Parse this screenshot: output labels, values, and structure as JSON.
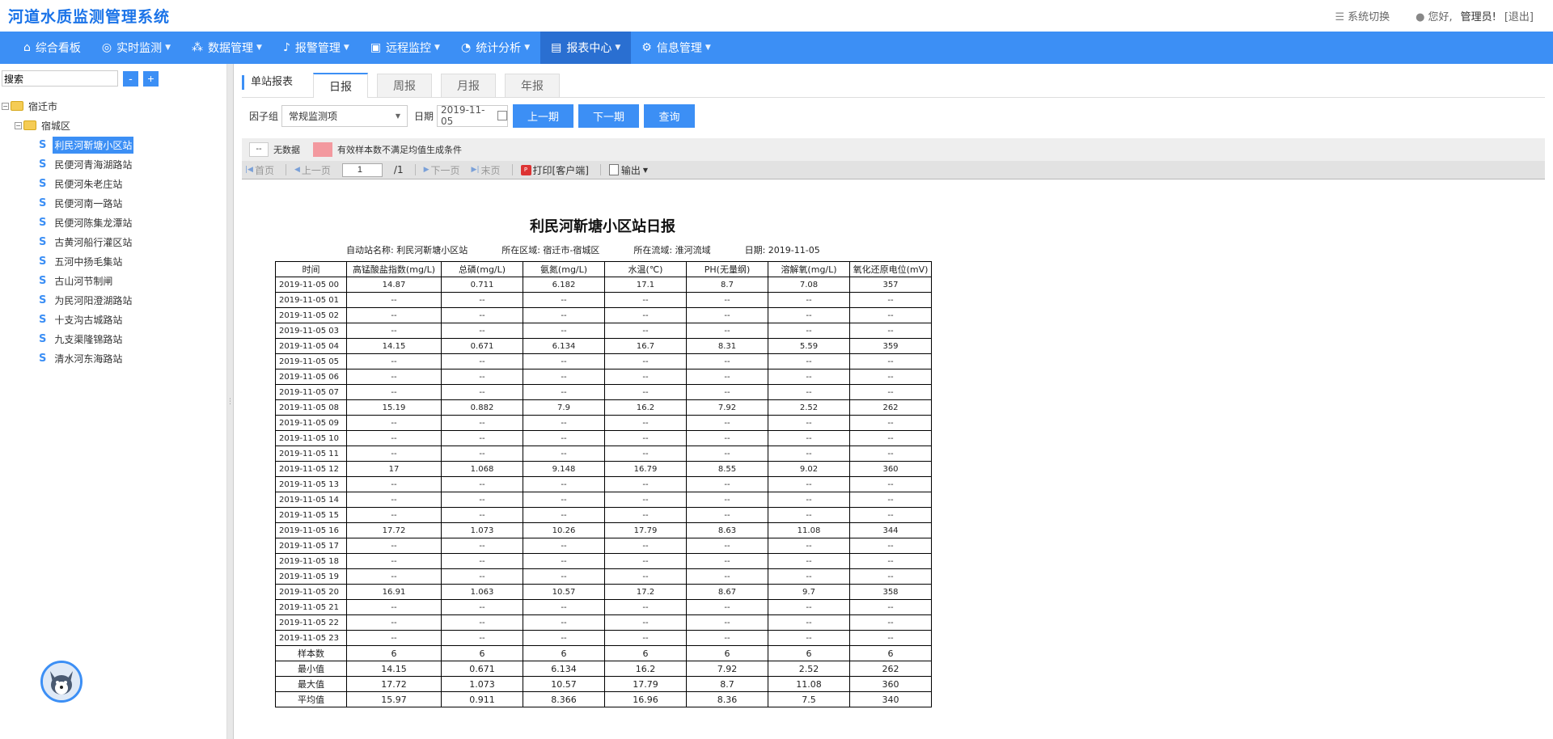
{
  "header": {
    "app_title": "河道水质监测管理系统",
    "switch_system": "系统切换",
    "greeting": "您好,",
    "user": "管理员!",
    "logout": "[退出]"
  },
  "nav": [
    {
      "label": "综合看板",
      "icon": "home-icon",
      "caret": false
    },
    {
      "label": "实时监测",
      "icon": "monitor-icon",
      "caret": true
    },
    {
      "label": "数据管理",
      "icon": "nodes-icon",
      "caret": true
    },
    {
      "label": "报警管理",
      "icon": "bell-icon",
      "caret": true
    },
    {
      "label": "远程监控",
      "icon": "screen-icon",
      "caret": true
    },
    {
      "label": "统计分析",
      "icon": "pie-icon",
      "caret": true
    },
    {
      "label": "报表中心",
      "icon": "report-icon",
      "caret": true,
      "active": true
    },
    {
      "label": "信息管理",
      "icon": "gear-icon",
      "caret": true
    }
  ],
  "sidebar": {
    "search_value": "搜索",
    "minus": "-",
    "plus": "+",
    "root": "宿迁市",
    "district": "宿城区",
    "stations": [
      "利民河靳塘小区站",
      "民便河青海湖路站",
      "民便河朱老庄站",
      "民便河南一路站",
      "民便河陈集龙潭站",
      "古黄河船行灌区站",
      "五河中扬毛集站",
      "古山河节制闸",
      "为民河阳澄湖路站",
      "十支沟古城路站",
      "九支渠隆锦路站",
      "清水河东海路站"
    ],
    "selected_index": 0
  },
  "tabs": {
    "section_label": "单站报表",
    "items": [
      "日报",
      "周报",
      "月报",
      "年报"
    ],
    "active": 0
  },
  "filter": {
    "group_label": "因子组",
    "group_value": "常规监测项",
    "date_label": "日期",
    "date_value": "2019-11-05",
    "prev": "上一期",
    "next": "下一期",
    "query": "查询"
  },
  "legend": {
    "nodata_symbol": "--",
    "nodata_text": "无数据",
    "invalid_text": "有效样本数不满足均值生成条件",
    "invalid_color": "#f3999f"
  },
  "toolbar": {
    "first": "首页",
    "prev": "上一页",
    "page": "1",
    "total": "/1",
    "next": "下一页",
    "last": "末页",
    "print": "打印[客户端]",
    "export": "输出"
  },
  "report": {
    "title": "利民河靳塘小区站日报",
    "station": "自动站名称: 利民河靳塘小区站",
    "region": "所在区域: 宿迁市-宿城区",
    "basin": "所在流域: 淮河流域",
    "date": "日期: 2019-11-05",
    "columns": [
      "时间",
      "高锰酸盐指数(mg/L)",
      "总磷(mg/L)",
      "氨氮(mg/L)",
      "水温(℃)",
      "PH(无量纲)",
      "溶解氧(mg/L)",
      "氧化还原电位(mV)"
    ],
    "rows": [
      [
        "2019-11-05 00",
        "14.87",
        "0.711",
        "6.182",
        "17.1",
        "8.7",
        "7.08",
        "357"
      ],
      [
        "2019-11-05 01",
        "--",
        "--",
        "--",
        "--",
        "--",
        "--",
        "--"
      ],
      [
        "2019-11-05 02",
        "--",
        "--",
        "--",
        "--",
        "--",
        "--",
        "--"
      ],
      [
        "2019-11-05 03",
        "--",
        "--",
        "--",
        "--",
        "--",
        "--",
        "--"
      ],
      [
        "2019-11-05 04",
        "14.15",
        "0.671",
        "6.134",
        "16.7",
        "8.31",
        "5.59",
        "359"
      ],
      [
        "2019-11-05 05",
        "--",
        "--",
        "--",
        "--",
        "--",
        "--",
        "--"
      ],
      [
        "2019-11-05 06",
        "--",
        "--",
        "--",
        "--",
        "--",
        "--",
        "--"
      ],
      [
        "2019-11-05 07",
        "--",
        "--",
        "--",
        "--",
        "--",
        "--",
        "--"
      ],
      [
        "2019-11-05 08",
        "15.19",
        "0.882",
        "7.9",
        "16.2",
        "7.92",
        "2.52",
        "262"
      ],
      [
        "2019-11-05 09",
        "--",
        "--",
        "--",
        "--",
        "--",
        "--",
        "--"
      ],
      [
        "2019-11-05 10",
        "--",
        "--",
        "--",
        "--",
        "--",
        "--",
        "--"
      ],
      [
        "2019-11-05 11",
        "--",
        "--",
        "--",
        "--",
        "--",
        "--",
        "--"
      ],
      [
        "2019-11-05 12",
        "17",
        "1.068",
        "9.148",
        "16.79",
        "8.55",
        "9.02",
        "360"
      ],
      [
        "2019-11-05 13",
        "--",
        "--",
        "--",
        "--",
        "--",
        "--",
        "--"
      ],
      [
        "2019-11-05 14",
        "--",
        "--",
        "--",
        "--",
        "--",
        "--",
        "--"
      ],
      [
        "2019-11-05 15",
        "--",
        "--",
        "--",
        "--",
        "--",
        "--",
        "--"
      ],
      [
        "2019-11-05 16",
        "17.72",
        "1.073",
        "10.26",
        "17.79",
        "8.63",
        "11.08",
        "344"
      ],
      [
        "2019-11-05 17",
        "--",
        "--",
        "--",
        "--",
        "--",
        "--",
        "--"
      ],
      [
        "2019-11-05 18",
        "--",
        "--",
        "--",
        "--",
        "--",
        "--",
        "--"
      ],
      [
        "2019-11-05 19",
        "--",
        "--",
        "--",
        "--",
        "--",
        "--",
        "--"
      ],
      [
        "2019-11-05 20",
        "16.91",
        "1.063",
        "10.57",
        "17.2",
        "8.67",
        "9.7",
        "358"
      ],
      [
        "2019-11-05 21",
        "--",
        "--",
        "--",
        "--",
        "--",
        "--",
        "--"
      ],
      [
        "2019-11-05 22",
        "--",
        "--",
        "--",
        "--",
        "--",
        "--",
        "--"
      ],
      [
        "2019-11-05 23",
        "--",
        "--",
        "--",
        "--",
        "--",
        "--",
        "--"
      ]
    ],
    "stats": [
      [
        "样本数",
        "6",
        "6",
        "6",
        "6",
        "6",
        "6",
        "6"
      ],
      [
        "最小值",
        "14.15",
        "0.671",
        "6.134",
        "16.2",
        "7.92",
        "2.52",
        "262"
      ],
      [
        "最大值",
        "17.72",
        "1.073",
        "10.57",
        "17.79",
        "8.7",
        "11.08",
        "360"
      ],
      [
        "平均值",
        "15.97",
        "0.911",
        "8.366",
        "16.96",
        "8.36",
        "7.5",
        "340"
      ]
    ]
  }
}
